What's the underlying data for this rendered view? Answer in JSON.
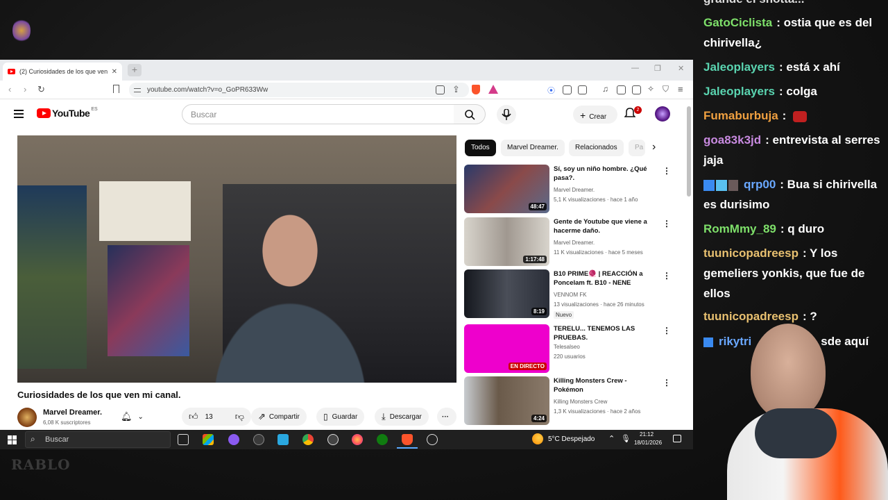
{
  "browser": {
    "tab_title": "(2) Curiosidades de los que ven",
    "url": "youtube.com/watch?v=o_GoPR633Ww"
  },
  "youtube": {
    "logo_text": "YouTube",
    "region": "ES",
    "search_placeholder": "Buscar",
    "create_label": "Crear",
    "notif_count": "2",
    "video_title": "Curiosidades de los que ven mi canal.",
    "channel_name": "Marvel Dreamer.",
    "channel_subs": "6,08 K suscriptores",
    "likes": "13",
    "share_label": "Compartir",
    "save_label": "Guardar",
    "download_label": "Descargar",
    "chips": [
      "Todos",
      "Marvel Dreamer.",
      "Relacionados",
      "Pa"
    ],
    "recommendations": [
      {
        "title": "Sí, soy un niño hombre. ¿Qué pasa?.",
        "channel": "Marvel Dreamer.",
        "meta": "5,1 K visualizaciones · hace 1 año",
        "duration": "48:47",
        "color": "#5a6a8a"
      },
      {
        "title": "Gente de Youtube que viene a hacerme daño.",
        "channel": "Marvel Dreamer.",
        "meta": "11 K visualizaciones · hace 5 meses",
        "duration": "1:17:48",
        "color": "#c9c4bc"
      },
      {
        "title": "B10 PRIME🧶 | REACCIÓN a Poncelam ft. B10 - NENE",
        "channel": "VENNOM FK",
        "meta": "13 visualizaciones · hace 26 minutos",
        "duration": "8:19",
        "badge": "Nuevo",
        "color": "#2a2e38"
      },
      {
        "title": "TERELU... TENEMOS LAS PRUEBAS.",
        "channel": "Telesalseo",
        "meta": "220 usuarios",
        "duration": "EN DIRECTO",
        "color": "#ee00cc"
      },
      {
        "title": "Killing Monsters Crew  - Pokémon",
        "channel": "Killing Monsters Crew",
        "meta": "1,3 K visualizaciones · hace 2 años",
        "duration": "4:24",
        "color": "#7a8e9a"
      }
    ]
  },
  "taskbar": {
    "search_label": "Buscar",
    "weather": "5°C  Despejado",
    "time": "21:12",
    "date": "18/01/2026"
  },
  "chat": [
    {
      "user": "GatoCiclista",
      "msg": ": ostia que es del chirivella¿",
      "color": "#7ee06a"
    },
    {
      "user": "Jaleoplayers",
      "msg": ": está x ahí",
      "color": "#5ad4b0"
    },
    {
      "user": "Jaleoplayers",
      "msg": ": colga",
      "color": "#5ad4b0"
    },
    {
      "user": "Fumaburbuja",
      "msg": ":",
      "color": "#f0a040"
    },
    {
      "user": "goa83k3jd",
      "msg": ": entrevista al serres jaja",
      "color": "#c88ae0"
    },
    {
      "user": "qrp00",
      "msg": ": Bua si chirivella es durisimo",
      "color": "#6aa8ff"
    },
    {
      "user": "RomMmy_89",
      "msg": ": q duro",
      "color": "#7ee06a"
    },
    {
      "user": "tuunicopadreesp",
      "msg": ": Y los gemeliers yonkis, que fue de ellos",
      "color": "#e8c070"
    },
    {
      "user": "tuunicopadreesp",
      "msg": ": ?",
      "color": "#e8c070"
    },
    {
      "user": "rikytri",
      "msg": "sde aquí",
      "color": "#6aa8ff"
    }
  ],
  "chat_top_fragment": "grande el shotta..."
}
